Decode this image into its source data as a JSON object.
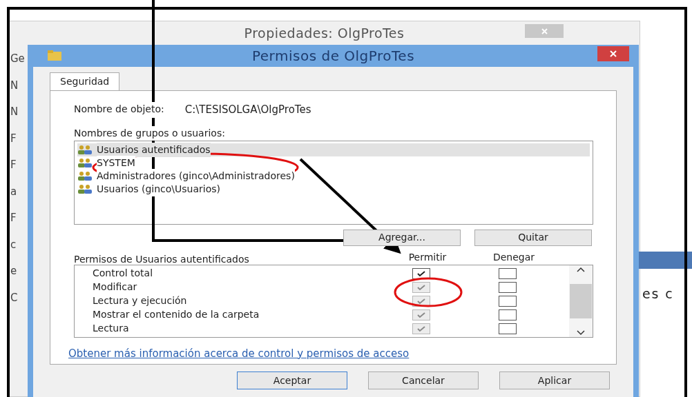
{
  "background_window": {
    "title": "Propiedades: OlgProTes",
    "left_fragments": [
      "Ge",
      "N",
      "N",
      "F",
      "F",
      "a",
      "F",
      "c",
      "e",
      "C"
    ],
    "right_fragment": "es c"
  },
  "dialog": {
    "title": "Permisos de OlgProTes",
    "tab": {
      "label": "Seguridad",
      "selected": true
    },
    "object_label": "Nombre de objeto:",
    "object_path": "C:\\TESISOLGA\\OlgProTes",
    "groups_label": "Nombres de grupos o usuarios:",
    "groups": [
      {
        "name": "Usuarios autentificados",
        "selected": true
      },
      {
        "name": "SYSTEM",
        "selected": false
      },
      {
        "name": "Administradores (ginco\\Administradores)",
        "selected": false
      },
      {
        "name": "Usuarios (ginco\\Usuarios)",
        "selected": false
      }
    ],
    "group_buttons": [
      "Agregar...",
      "Quitar"
    ],
    "permissions_label": "Permisos de Usuarios autentificados",
    "columns": [
      "Permitir",
      "Denegar"
    ],
    "permissions": [
      {
        "name": "Control total",
        "allow": true,
        "allow_disabled": false,
        "deny": false
      },
      {
        "name": "Modificar",
        "allow": true,
        "allow_disabled": true,
        "deny": false
      },
      {
        "name": "Lectura y ejecución",
        "allow": true,
        "allow_disabled": true,
        "deny": false
      },
      {
        "name": "Mostrar el contenido de la carpeta",
        "allow": true,
        "allow_disabled": true,
        "deny": false
      },
      {
        "name": "Lectura",
        "allow": true,
        "allow_disabled": true,
        "deny": false
      }
    ],
    "link": "Obtener más información acerca de control y permisos de acceso",
    "buttons": [
      {
        "label": "Aceptar",
        "selected": true
      },
      {
        "label": "Cancelar",
        "selected": false
      },
      {
        "label": "Aplicar",
        "selected": false
      }
    ]
  }
}
